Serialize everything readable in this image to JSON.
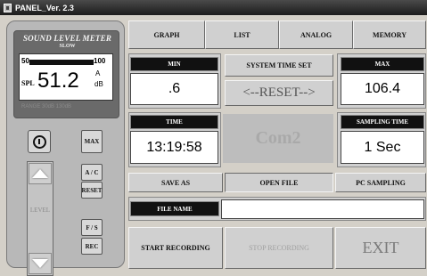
{
  "window": {
    "title": "PANEL_Ver. 2.3"
  },
  "meter": {
    "title": "SOUND LEVEL METER",
    "mode": "SLOW",
    "range_low": "50",
    "range_high": "100",
    "spl_label": "SPL",
    "value": "51.2",
    "weighting": "A",
    "unit": "dB",
    "footer": "RANGE 30dB 130dB",
    "level_label": "LEVEL"
  },
  "side_buttons": {
    "max": "MAX",
    "ac": "A / C",
    "reset": "RESET",
    "fs": "F / S",
    "rec": "REC"
  },
  "tabs": [
    "GRAPH",
    "LIST",
    "ANALOG",
    "MEMORY"
  ],
  "readouts": {
    "min_label": "MIN",
    "min_value": ".6",
    "max_label": "MAX",
    "max_value": "106.4",
    "time_label": "TIME",
    "time_value": "13:19:58",
    "sampling_label": "SAMPLING TIME",
    "sampling_value": "1 Sec"
  },
  "controls": {
    "system_time_set": "SYSTEM TIME SET",
    "reset": "<--RESET-->",
    "com_port": "Com2",
    "save_as": "SAVE AS",
    "open_file": "OPEN FILE",
    "pc_sampling": "PC SAMPLING",
    "file_name_label": "FILE NAME",
    "file_name_value": "",
    "start_recording": "START RECORDING",
    "stop_recording": "STOP RECORDING",
    "exit": "EXIT"
  },
  "colors": {
    "panel_bg": "#d4d0c8",
    "label_bg": "#111111",
    "disabled_text": "#a0a0a0"
  }
}
